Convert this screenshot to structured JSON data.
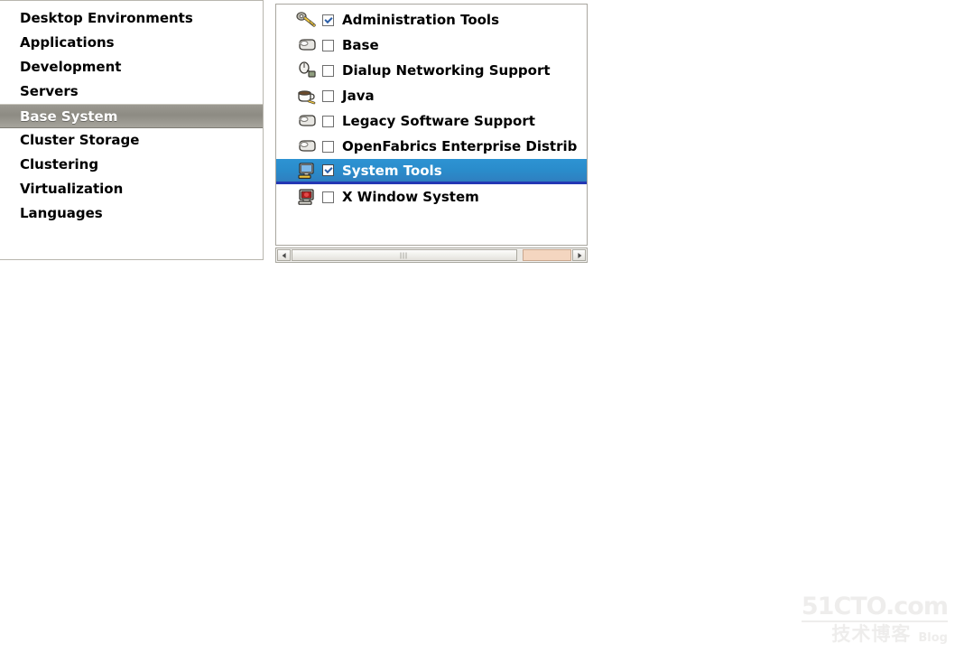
{
  "categories": {
    "selected_index": 4,
    "items": [
      {
        "label": "Desktop Environments"
      },
      {
        "label": "Applications"
      },
      {
        "label": "Development"
      },
      {
        "label": "Servers"
      },
      {
        "label": "Base System"
      },
      {
        "label": "Cluster Storage"
      },
      {
        "label": "Clustering"
      },
      {
        "label": "Virtualization"
      },
      {
        "label": "Languages"
      }
    ]
  },
  "packages": {
    "selected_index": 6,
    "items": [
      {
        "label": "Administration Tools",
        "checked": true,
        "icon": "key-icon"
      },
      {
        "label": "Base",
        "checked": false,
        "icon": "package-disc-icon"
      },
      {
        "label": "Dialup Networking Support",
        "checked": false,
        "icon": "mouse-icon"
      },
      {
        "label": "Java",
        "checked": false,
        "icon": "coffee-cup-icon"
      },
      {
        "label": "Legacy Software Support",
        "checked": false,
        "icon": "package-disc-icon"
      },
      {
        "label": "OpenFabrics Enterprise Distrib",
        "checked": false,
        "icon": "package-disc-icon"
      },
      {
        "label": "System Tools",
        "checked": true,
        "icon": "computer-icon"
      },
      {
        "label": "X Window System",
        "checked": false,
        "icon": "monitor-red-icon"
      }
    ]
  },
  "scrollbar": {
    "left_arrow": "◀",
    "right_arrow": "▶"
  },
  "watermark": {
    "site": "51CTO.com",
    "chinese": "技术博客",
    "blog": "Blog"
  },
  "colors": {
    "selection_blue": "#2a8ccb",
    "selection_blue_border": "#2438b4",
    "selection_grey": "#8d8b83",
    "panel_border": "#a9a79f",
    "scroll_hot": "#f4d6c0"
  }
}
